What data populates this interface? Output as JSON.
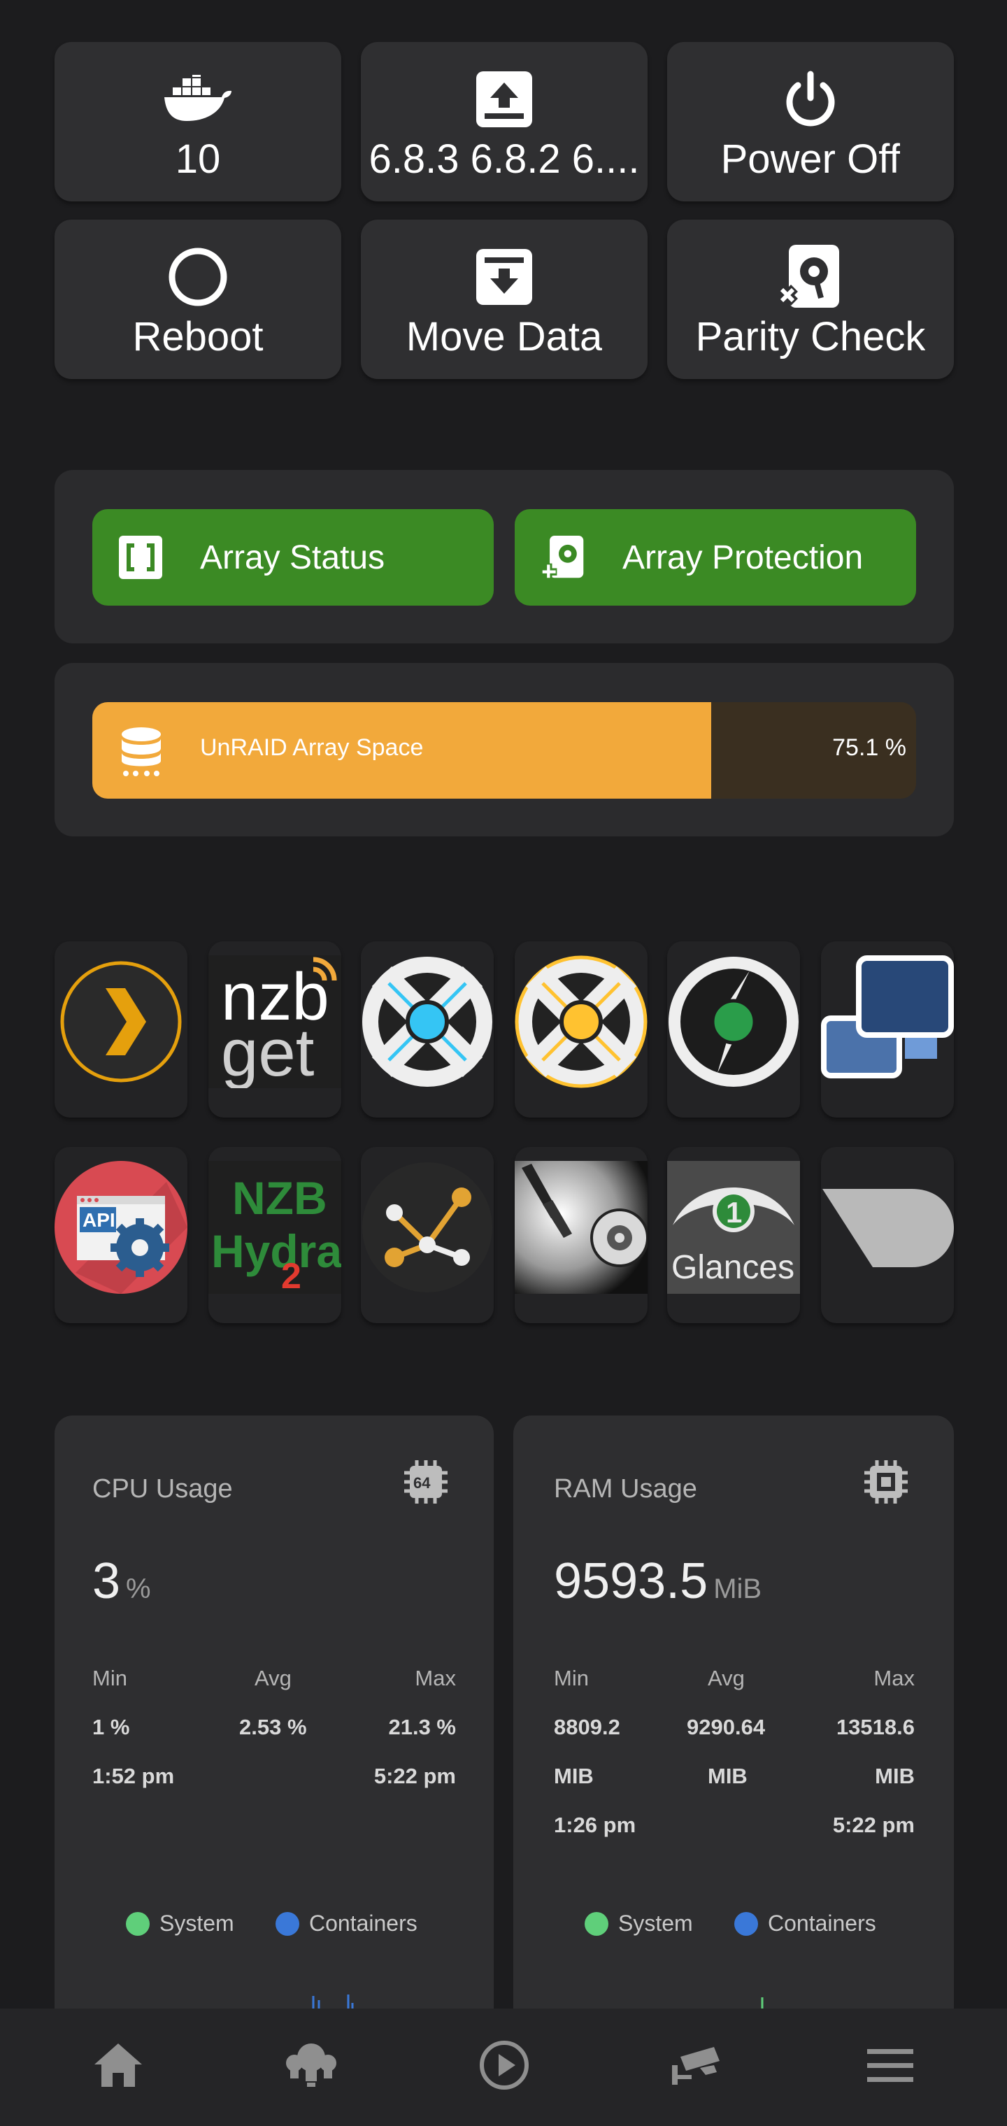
{
  "quick_actions": {
    "docker": {
      "label": "10",
      "icon": "docker-icon"
    },
    "update": {
      "label": "6.8.3 6.8.2 6....",
      "icon": "upload-box-icon"
    },
    "power_off": {
      "label": "Power Off",
      "icon": "power-icon"
    },
    "reboot": {
      "label": "Reboot",
      "icon": "circle-icon"
    },
    "move_data": {
      "label": "Move Data",
      "icon": "download-box-icon"
    },
    "parity_check": {
      "label": "Parity Check",
      "icon": "harddisk-check-icon"
    }
  },
  "array": {
    "status_label": "Array Status",
    "protection_label": "Array Protection",
    "space_label": "UnRAID Array Space",
    "space_value": "75.1 %",
    "space_fraction": 0.751
  },
  "apps": [
    {
      "name": "plex-logo"
    },
    {
      "name": "nzbget-logo"
    },
    {
      "name": "sonarr-logo"
    },
    {
      "name": "radarr-logo"
    },
    {
      "name": "lidarr-logo"
    },
    {
      "name": "virtual-desktops-logo"
    },
    {
      "name": "api-settings-logo"
    },
    {
      "name": "nzbhydra2-logo"
    },
    {
      "name": "network-graph-logo"
    },
    {
      "name": "harddisk-logo"
    },
    {
      "name": "glances-logo"
    },
    {
      "name": "grey-shape-logo"
    }
  ],
  "app_text": {
    "nzb": "nzb",
    "get": "get",
    "api": "API",
    "nzbh_top": "NZB",
    "nzbh_bottom": "Hydra",
    "nzbh_num": "2",
    "glances_num": "1",
    "glances": "Glances"
  },
  "cpu": {
    "title": "CPU Usage",
    "chip_text": "64",
    "value": "3",
    "unit": "%",
    "min_label": "Min",
    "avg_label": "Avg",
    "max_label": "Max",
    "min_value": "1 %",
    "avg_value": "2.53 %",
    "max_value": "21.3 %",
    "min_time": "1:52 pm",
    "max_time": "5:22 pm",
    "legend_system": "System",
    "legend_containers": "Containers"
  },
  "ram": {
    "title": "RAM Usage",
    "value": "9593.5",
    "unit": "MiB",
    "min_label": "Min",
    "avg_label": "Avg",
    "max_label": "Max",
    "min_value": "8809.2",
    "avg_value": "9290.64",
    "max_value": "13518.6",
    "min_unit": "MIB",
    "avg_unit": "MIB",
    "max_unit": "MIB",
    "min_time": "1:26 pm",
    "max_time": "5:22 pm",
    "legend_system": "System",
    "legend_containers": "Containers"
  },
  "colors": {
    "green": "#3b8a24",
    "orange": "#f2a93b",
    "system": "#5fcf7a",
    "containers": "#3a78d8"
  },
  "nav": [
    {
      "icon": "home-icon"
    },
    {
      "icon": "lightbulb-group-icon"
    },
    {
      "icon": "play-circle-icon"
    },
    {
      "icon": "cctv-icon"
    },
    {
      "icon": "menu-icon"
    }
  ]
}
